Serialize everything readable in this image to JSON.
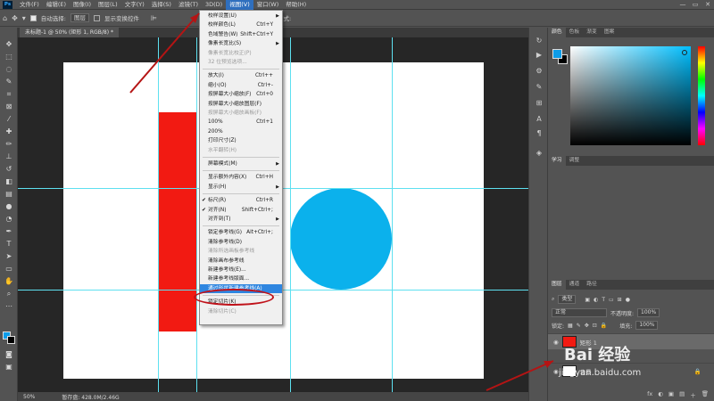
{
  "menubar": {
    "logo": "Ps",
    "items": [
      "文件(F)",
      "编辑(E)",
      "图像(I)",
      "图层(L)",
      "文字(Y)",
      "选择(S)",
      "滤镜(T)",
      "3D(D)",
      "视图(V)",
      "窗口(W)",
      "帮助(H)"
    ],
    "active_index": 8,
    "window_controls": [
      "—",
      "▭",
      "✕"
    ]
  },
  "optbar": {
    "auto_select_label": "自动选择:",
    "auto_select_value": "图层",
    "transform_label": "显示变换控件",
    "mode_label": "模式:"
  },
  "document": {
    "tab_title": "未标题-1 @ 50% (矩形 1, RGB/8) *",
    "zoom": "50%",
    "status": "暂存盘: 428.0M/2.46G"
  },
  "view_menu": {
    "items": [
      {
        "label": "校样设置(U)",
        "shortcut": "",
        "arrow": true,
        "disabled": false
      },
      {
        "label": "校样颜色(L)",
        "shortcut": "Ctrl+Y",
        "arrow": false,
        "disabled": false
      },
      {
        "label": "色域警告(W)",
        "shortcut": "Shift+Ctrl+Y",
        "arrow": false,
        "disabled": false
      },
      {
        "label": "像素长宽比(S)",
        "shortcut": "",
        "arrow": true,
        "disabled": false
      },
      {
        "label": "像素长宽比校正(P)",
        "shortcut": "",
        "arrow": false,
        "disabled": true
      },
      {
        "label": "32 位预览选项...",
        "shortcut": "",
        "arrow": false,
        "disabled": true
      },
      {
        "label": "放大(I)",
        "shortcut": "Ctrl++",
        "arrow": false,
        "disabled": false
      },
      {
        "label": "缩小(O)",
        "shortcut": "Ctrl+-",
        "arrow": false,
        "disabled": false
      },
      {
        "label": "按屏幕大小缩放(F)",
        "shortcut": "Ctrl+0",
        "arrow": false,
        "disabled": false
      },
      {
        "label": "按屏幕大小缩放图层(F)",
        "shortcut": "",
        "arrow": false,
        "disabled": false
      },
      {
        "label": "按屏幕大小缩放画板(F)",
        "shortcut": "",
        "arrow": false,
        "disabled": true
      },
      {
        "label": "100%",
        "shortcut": "Ctrl+1",
        "arrow": false,
        "disabled": false
      },
      {
        "label": "200%",
        "shortcut": "",
        "arrow": false,
        "disabled": false
      },
      {
        "label": "打印尺寸(Z)",
        "shortcut": "",
        "arrow": false,
        "disabled": false
      },
      {
        "label": "水平翻转(H)",
        "shortcut": "",
        "arrow": false,
        "disabled": true
      },
      {
        "label": "屏幕模式(M)",
        "shortcut": "",
        "arrow": true,
        "disabled": false
      },
      {
        "label": "显示额外内容(X)",
        "shortcut": "Ctrl+H",
        "arrow": false,
        "disabled": false
      },
      {
        "label": "显示(H)",
        "shortcut": "",
        "arrow": true,
        "disabled": false
      },
      {
        "label": "标尺(R)",
        "shortcut": "Ctrl+R",
        "arrow": false,
        "disabled": false,
        "checked": true
      },
      {
        "label": "对齐(N)",
        "shortcut": "Shift+Ctrl+;",
        "arrow": false,
        "disabled": false,
        "checked": true
      },
      {
        "label": "对齐到(T)",
        "shortcut": "",
        "arrow": true,
        "disabled": false
      },
      {
        "label": "锁定参考线(G)",
        "shortcut": "Alt+Ctrl+;",
        "arrow": false,
        "disabled": false
      },
      {
        "label": "清除参考线(D)",
        "shortcut": "",
        "arrow": false,
        "disabled": false
      },
      {
        "label": "清除所选画板参考线",
        "shortcut": "",
        "arrow": false,
        "disabled": true
      },
      {
        "label": "清除画布参考线",
        "shortcut": "",
        "arrow": false,
        "disabled": false
      },
      {
        "label": "新建参考线(E)...",
        "shortcut": "",
        "arrow": false,
        "disabled": false
      },
      {
        "label": "新建参考线版面...",
        "shortcut": "",
        "arrow": false,
        "disabled": false
      },
      {
        "label": "通过形状新建参考线(A)",
        "shortcut": "",
        "arrow": false,
        "disabled": false,
        "highlight": true
      },
      {
        "label": "锁定切片(K)",
        "shortcut": "",
        "arrow": false,
        "disabled": false
      },
      {
        "label": "清除切片(C)",
        "shortcut": "",
        "arrow": false,
        "disabled": true
      }
    ]
  },
  "panels": {
    "color_tabs": [
      "颜色",
      "色板",
      "渐变",
      "图案"
    ],
    "learn_tabs": [
      "学习",
      "调整"
    ],
    "layers_tabs": [
      "图层",
      "通道",
      "路径"
    ],
    "kind_label": "类型",
    "blend_mode": "正常",
    "opacity_label": "不透明度:",
    "opacity_value": "100%",
    "lock_label": "锁定:",
    "fill_label": "填充:",
    "fill_value": "100%",
    "layers": [
      {
        "name": "矩形 1",
        "active": true
      },
      {
        "name": "背景",
        "active": false
      }
    ],
    "bottom_icons": [
      "fx",
      "◐",
      "▣",
      "▤",
      "＋",
      "🗑"
    ]
  },
  "colors": {
    "fg": "#0d9ce8",
    "bg": "#000000",
    "red_rect": "#f21a12",
    "circle": "#0bb1ec",
    "guide": "#5ee0f0",
    "annotation": "#b51414"
  },
  "watermark": {
    "brand": "Bai 经验",
    "url": "jingyan.baidu.com"
  }
}
